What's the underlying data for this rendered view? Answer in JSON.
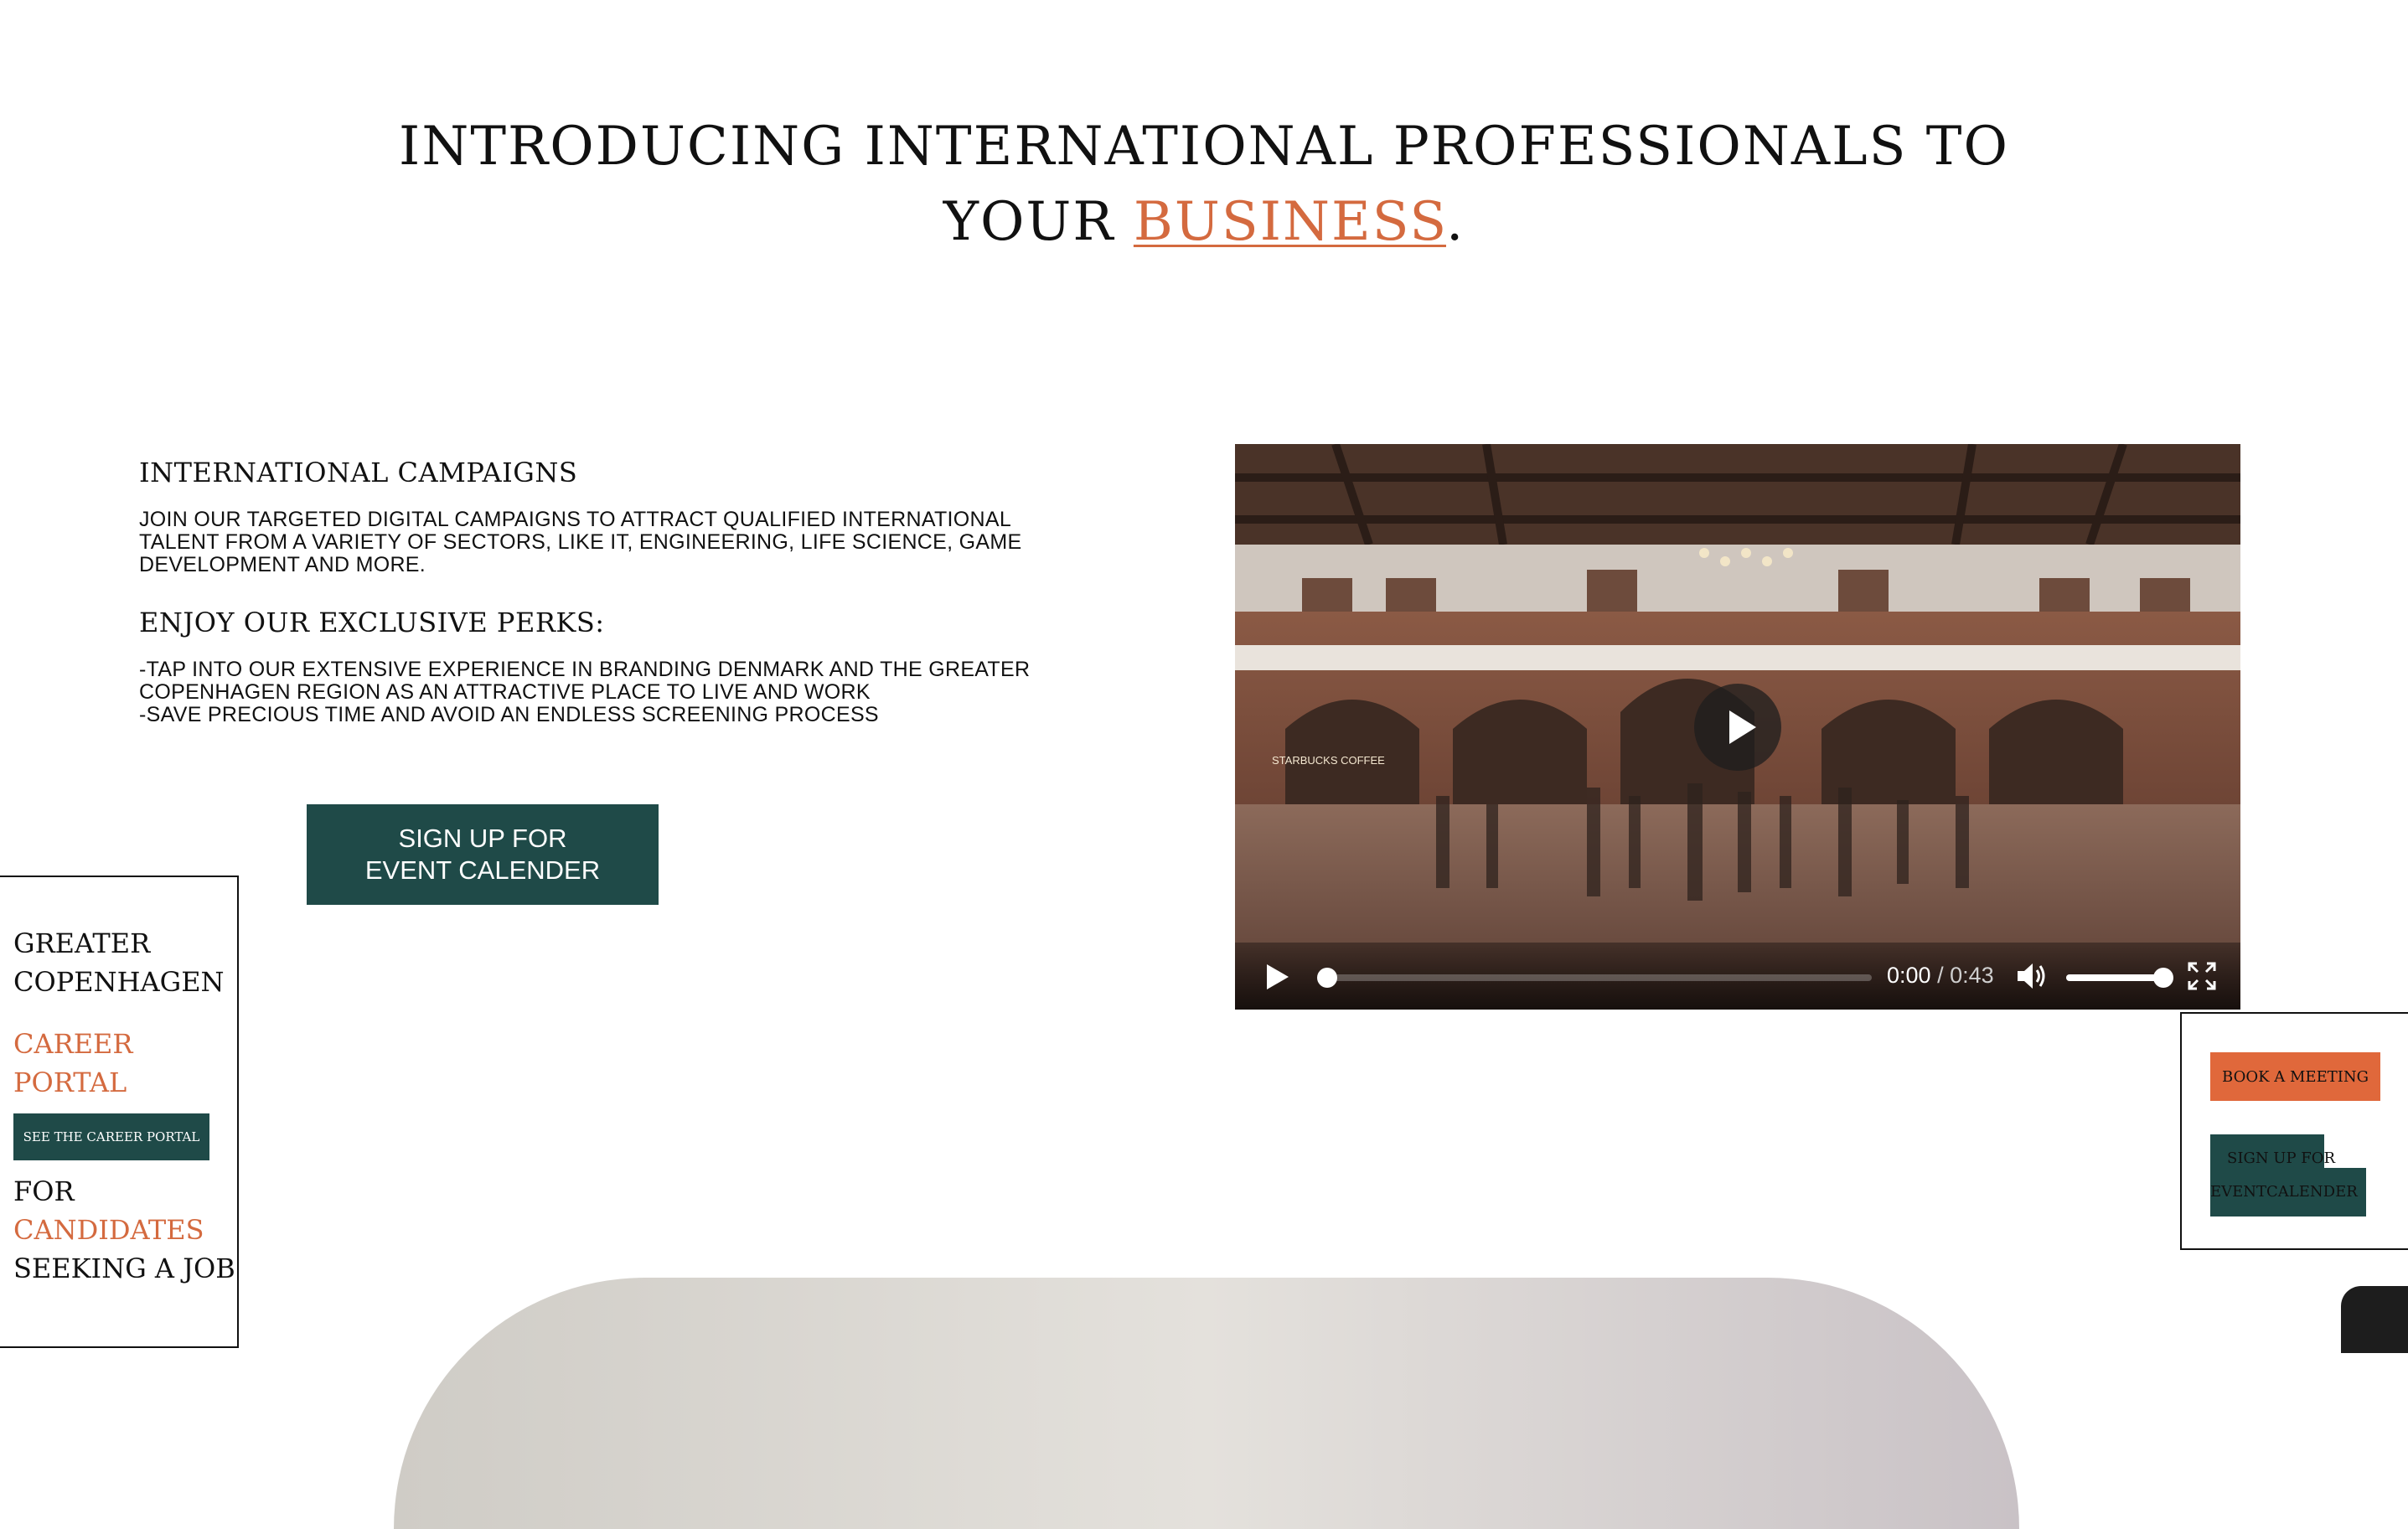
{
  "hero": {
    "line1": "INTRODUCING INTERNATIONAL PROFESSIONALS TO",
    "line2_prefix": "YOUR",
    "line2_accent": "BUSINESS",
    "line2_suffix": "."
  },
  "campaigns": {
    "heading": "INTERNATIONAL CAMPAIGNS",
    "body": "JOIN OUR TARGETED DIGITAL CAMPAIGNS TO ATTRACT QUALIFIED INTERNATIONAL TALENT FROM A VARIETY OF SECTORS, LIKE IT, ENGINEERING, LIFE SCIENCE, GAME DEVELOPMENT AND MORE.",
    "perks_heading": "ENJOY OUR EXCLUSIVE PERKS:",
    "perks": [
      "-TAP INTO OUR EXTENSIVE EXPERIENCE IN BRANDING DENMARK AND THE GREATER COPENHAGEN REGION AS AN ATTRACTIVE PLACE TO LIVE AND WORK",
      "-SAVE PRECIOUS TIME AND AVOID AN ENDLESS SCREENING PROCESS"
    ],
    "cta_line1": "SIGN UP FOR",
    "cta_line2": "EVENT CALENDER"
  },
  "video": {
    "current_time": "0:00",
    "separator": " / ",
    "duration": "0:43",
    "progress": 0.0,
    "volume": 1.0,
    "poster_sign": "STARBUCKS COFFEE",
    "icons": [
      "play-icon",
      "volume-icon",
      "fullscreen-icon"
    ]
  },
  "side_widget": {
    "title_line1": "GREATER",
    "title_line2": "COPENHAGEN",
    "accent_line1": "CAREER",
    "accent_line2": "PORTAL",
    "button": "SEE THE CAREER PORTAL",
    "for": "FOR",
    "candidates": "CANDIDATES",
    "seeking": "SEEKING A JOB"
  },
  "right_widget": {
    "book": "BOOK A MEETING",
    "sign_line1": "SIGN UP FOR",
    "sign_line2": "EVENTCALENDER"
  },
  "colors": {
    "accent": "#d46a3f",
    "button_dark": "#1f4a48",
    "book_button": "#e0683b",
    "text": "#111111"
  }
}
